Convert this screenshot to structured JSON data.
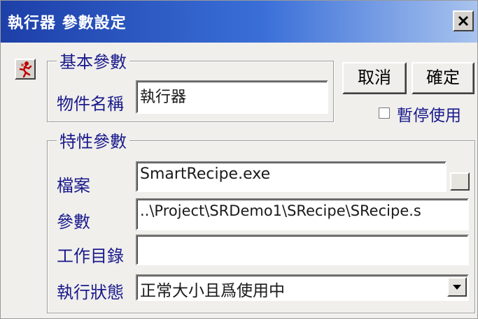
{
  "window": {
    "title": "執行器 參數設定",
    "close_glyph": "✕"
  },
  "basic_group": {
    "legend": "基本參數",
    "name_label": "物件名稱",
    "name_value": "執行器"
  },
  "buttons": {
    "cancel": "取消",
    "ok": "確定"
  },
  "pause_checkbox": {
    "label": "暫停使用",
    "checked": false
  },
  "properties_group": {
    "legend": "特性參數",
    "file_label": "檔案",
    "file_value": "SmartRecipe.exe",
    "params_label": "參數",
    "params_value": "..\\Project\\SRDemo1\\SRecipe\\SRecipe.s",
    "workdir_label": "工作目錄",
    "workdir_value": "",
    "state_label": "執行狀態",
    "state_value": "正常大小且爲使用中"
  },
  "icons": {
    "runner": "running-man-icon",
    "dropdown": "dropdown-arrow-icon"
  }
}
